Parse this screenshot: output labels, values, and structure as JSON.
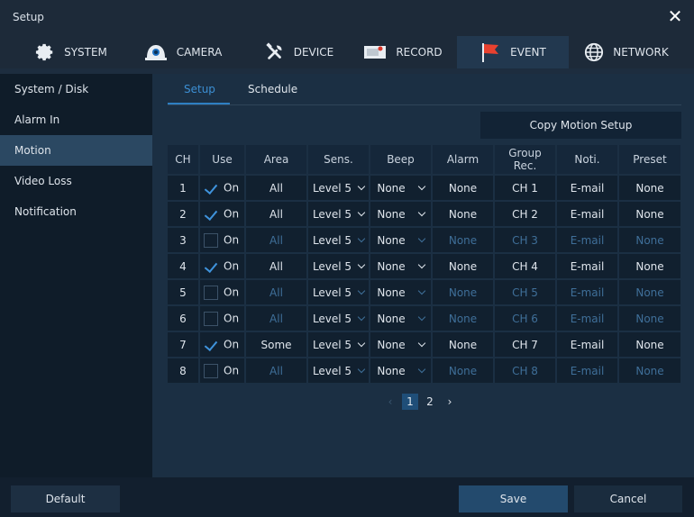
{
  "window": {
    "title": "Setup",
    "close_label": "✕"
  },
  "tabs": [
    {
      "label": "SYSTEM",
      "icon": "gear-icon"
    },
    {
      "label": "CAMERA",
      "icon": "camera-icon"
    },
    {
      "label": "DEVICE",
      "icon": "tools-icon"
    },
    {
      "label": "RECORD",
      "icon": "record-icon"
    },
    {
      "label": "EVENT",
      "icon": "flag-icon",
      "active": true
    },
    {
      "label": "NETWORK",
      "icon": "globe-icon"
    }
  ],
  "sidebar": {
    "items": [
      {
        "label": "System / Disk"
      },
      {
        "label": "Alarm In"
      },
      {
        "label": "Motion",
        "active": true
      },
      {
        "label": "Video Loss"
      },
      {
        "label": "Notification"
      }
    ]
  },
  "subtabs": [
    {
      "label": "Setup",
      "active": true
    },
    {
      "label": "Schedule"
    }
  ],
  "copy_button": "Copy Motion Setup",
  "table": {
    "headers": [
      "CH",
      "Use",
      "Area",
      "Sens.",
      "Beep",
      "Alarm",
      "Group\nRec.",
      "Noti.",
      "Preset"
    ],
    "rows": [
      {
        "ch": "1",
        "use": true,
        "use_label": "On",
        "area": "All",
        "sens": "Level 5",
        "beep": "None",
        "alarm": "None",
        "group": "CH 1",
        "noti": "E-mail",
        "preset": "None"
      },
      {
        "ch": "2",
        "use": true,
        "use_label": "On",
        "area": "All",
        "sens": "Level 5",
        "beep": "None",
        "alarm": "None",
        "group": "CH 2",
        "noti": "E-mail",
        "preset": "None"
      },
      {
        "ch": "3",
        "use": false,
        "use_label": "On",
        "area": "All",
        "sens": "Level 5",
        "beep": "None",
        "alarm": "None",
        "group": "CH 3",
        "noti": "E-mail",
        "preset": "None"
      },
      {
        "ch": "4",
        "use": true,
        "use_label": "On",
        "area": "All",
        "sens": "Level 5",
        "beep": "None",
        "alarm": "None",
        "group": "CH 4",
        "noti": "E-mail",
        "preset": "None"
      },
      {
        "ch": "5",
        "use": false,
        "use_label": "On",
        "area": "All",
        "sens": "Level 5",
        "beep": "None",
        "alarm": "None",
        "group": "CH 5",
        "noti": "E-mail",
        "preset": "None"
      },
      {
        "ch": "6",
        "use": false,
        "use_label": "On",
        "area": "All",
        "sens": "Level 5",
        "beep": "None",
        "alarm": "None",
        "group": "CH 6",
        "noti": "E-mail",
        "preset": "None"
      },
      {
        "ch": "7",
        "use": true,
        "use_label": "On",
        "area": "Some",
        "sens": "Level 5",
        "beep": "None",
        "alarm": "None",
        "group": "CH 7",
        "noti": "E-mail",
        "preset": "None"
      },
      {
        "ch": "8",
        "use": false,
        "use_label": "On",
        "area": "All",
        "sens": "Level 5",
        "beep": "None",
        "alarm": "None",
        "group": "CH 8",
        "noti": "E-mail",
        "preset": "None"
      }
    ]
  },
  "pagination": {
    "prev": "‹",
    "pages": [
      "1",
      "2"
    ],
    "current": "1",
    "next": "›"
  },
  "footer": {
    "default_label": "Default",
    "save_label": "Save",
    "cancel_label": "Cancel"
  },
  "colors": {
    "accent": "#3f93dc",
    "dim_text": "#3f6f99",
    "active_tab": "#22384f",
    "active_side": "#2b4862"
  }
}
